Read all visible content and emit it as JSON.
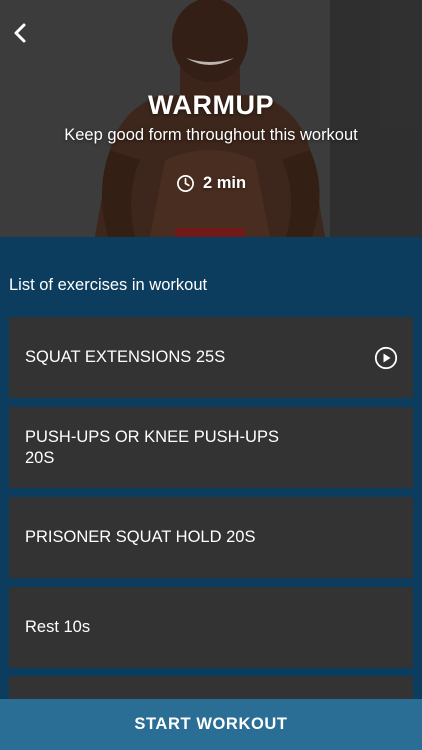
{
  "header": {
    "title": "WARMUP",
    "subtitle": "Keep good form throughout this workout",
    "duration": "2 min"
  },
  "icons": {
    "back": "chevron-left-icon",
    "clock": "clock-icon",
    "play": "play-circle-icon"
  },
  "list_heading": "List of exercises in workout",
  "exercises": [
    {
      "name": "SQUAT EXTENSIONS 25S",
      "has_play": true
    },
    {
      "name": "PUSH-UPS OR KNEE PUSH-UPS 20S",
      "has_play": false
    },
    {
      "name": "PRISONER SQUAT HOLD 20S",
      "has_play": false
    },
    {
      "name": "Rest 10s",
      "has_play": false
    },
    {
      "name": "",
      "has_play": false
    }
  ],
  "start_button": "START WORKOUT",
  "colors": {
    "background": "#0d3d5e",
    "card": "#333333",
    "button": "#2a6d95",
    "text": "#ffffff"
  }
}
